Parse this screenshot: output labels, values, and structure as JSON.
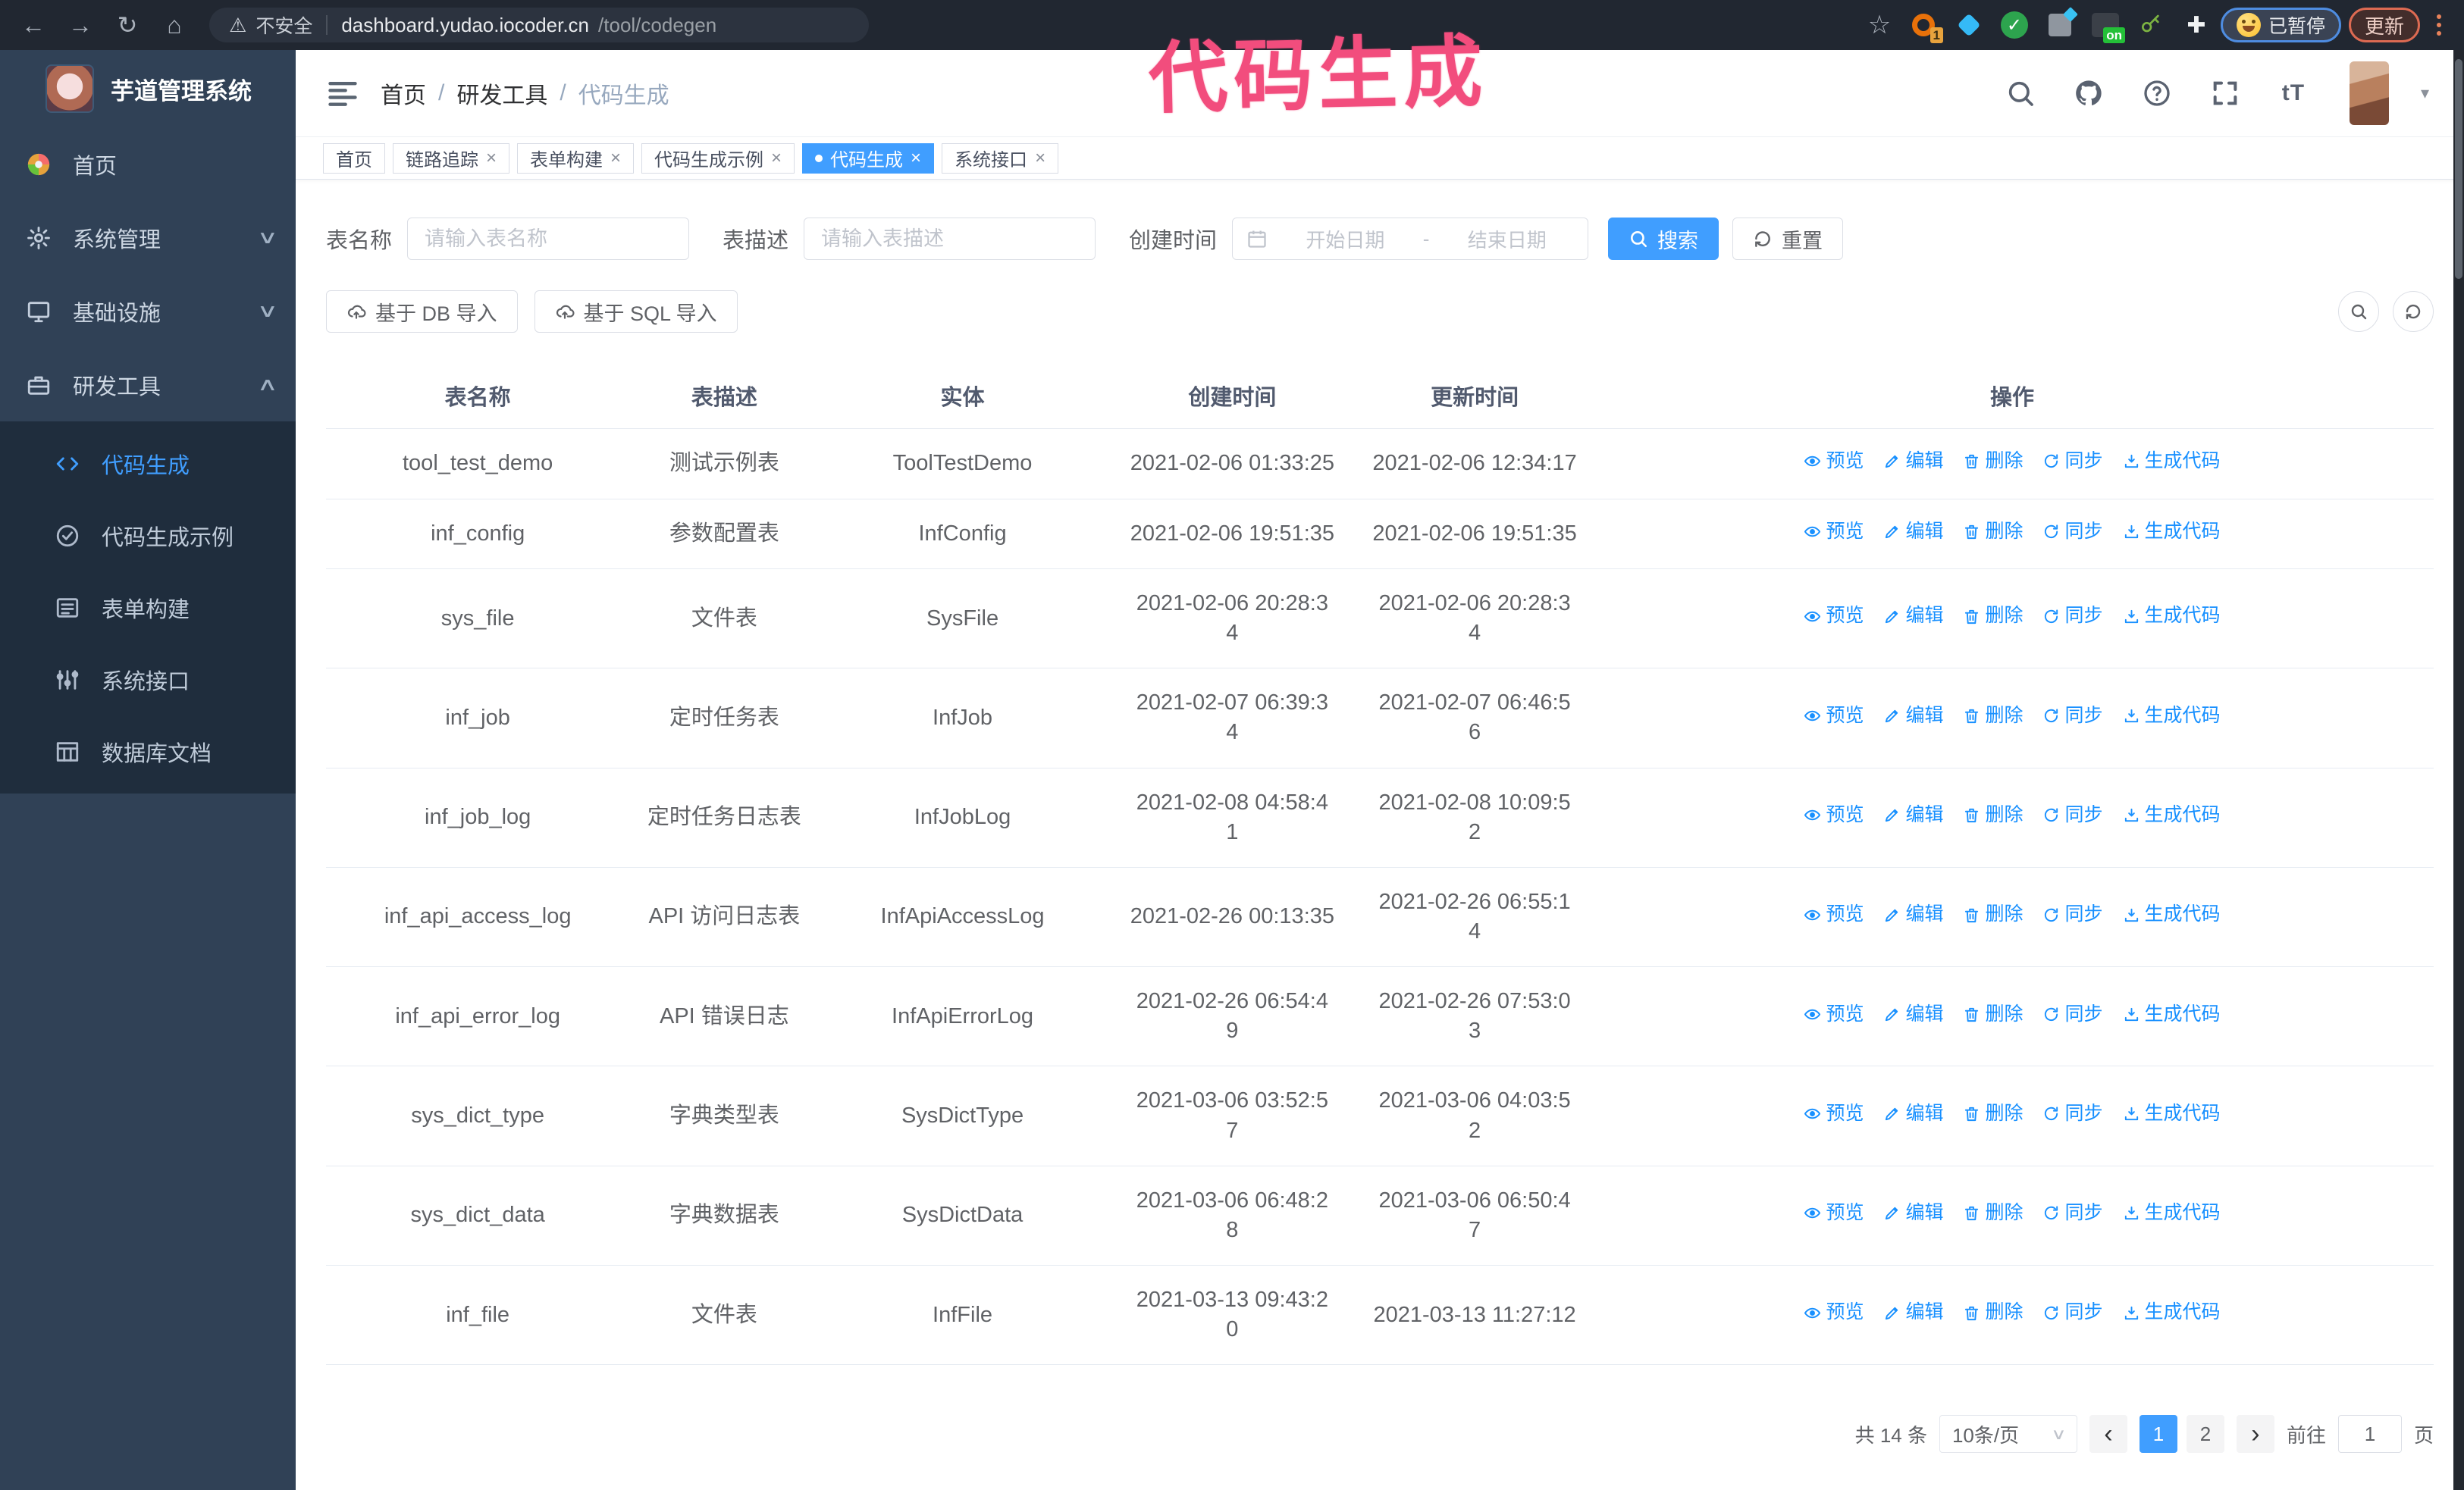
{
  "annotation": {
    "text": "代码生成"
  },
  "browser": {
    "security_label": "不安全",
    "url_host": "dashboard.yudao.iocoder.cn",
    "url_path": "/tool/codegen",
    "profile_label": "已暂停",
    "update_label": "更新",
    "extensions": [
      {
        "icon": "ring-orange-icon",
        "badge": "1"
      },
      {
        "icon": "gem-blue-icon",
        "badge": ""
      },
      {
        "icon": "check-green-icon",
        "badge": ""
      },
      {
        "icon": "panels-gray-icon",
        "badge": ""
      },
      {
        "icon": "switch-dark-icon",
        "badge": "on"
      },
      {
        "icon": "key-green-icon",
        "badge": ""
      },
      {
        "icon": "puzzle-white-icon",
        "badge": ""
      }
    ]
  },
  "icons": {
    "back": "←",
    "forward": "→",
    "reload": "↻",
    "home": "⌂",
    "star": "☆",
    "warning": "⚠",
    "close": "×",
    "chevron_down": "∨",
    "chevron_up": "∧",
    "prev": "‹",
    "next": "›",
    "check": "✓",
    "puzzle": "✚",
    "text_size": "tT",
    "caret_down": "▾"
  },
  "sidebar": {
    "logo_title": "芋道管理系统",
    "items": [
      {
        "key": "home",
        "label": "首页",
        "icon": "dashboard",
        "chevron": ""
      },
      {
        "key": "system-admin",
        "label": "系统管理",
        "icon": "gear",
        "chevron": "down"
      },
      {
        "key": "infrastructure",
        "label": "基础设施",
        "icon": "monitor",
        "chevron": "down"
      },
      {
        "key": "dev-tools",
        "label": "研发工具",
        "icon": "toolbox",
        "chevron": "up"
      }
    ],
    "submenu": [
      {
        "key": "codegen",
        "label": "代码生成",
        "icon": "code",
        "active": true
      },
      {
        "key": "codegen-example",
        "label": "代码生成示例",
        "icon": "badgecheck",
        "active": false
      },
      {
        "key": "form-builder",
        "label": "表单构建",
        "icon": "form",
        "active": false
      },
      {
        "key": "system-api",
        "label": "系统接口",
        "icon": "sliders",
        "active": false
      },
      {
        "key": "db-doc",
        "label": "数据库文档",
        "icon": "dbdoc",
        "active": false
      }
    ]
  },
  "header": {
    "breadcrumb": [
      "首页",
      "研发工具",
      "代码生成"
    ],
    "separator": "/"
  },
  "tabs": [
    {
      "label": "首页",
      "closable": false,
      "active": false
    },
    {
      "label": "链路追踪",
      "closable": true,
      "active": false
    },
    {
      "label": "表单构建",
      "closable": true,
      "active": false
    },
    {
      "label": "代码生成示例",
      "closable": true,
      "active": false
    },
    {
      "label": "代码生成",
      "closable": true,
      "active": true
    },
    {
      "label": "系统接口",
      "closable": true,
      "active": false
    }
  ],
  "filters": {
    "name_label": "表名称",
    "name_placeholder": "请输入表名称",
    "desc_label": "表描述",
    "desc_placeholder": "请输入表描述",
    "time_label": "创建时间",
    "start_placeholder": "开始日期",
    "range_separator": "-",
    "end_placeholder": "结束日期",
    "search_label": "搜索",
    "reset_label": "重置"
  },
  "toolbar": {
    "import_db": "基于 DB 导入",
    "import_sql": "基于 SQL 导入"
  },
  "table": {
    "columns": [
      "表名称",
      "表描述",
      "实体",
      "创建时间",
      "更新时间",
      "操作"
    ],
    "actions": [
      {
        "key": "preview",
        "label": "预览",
        "icon": "eye"
      },
      {
        "key": "edit",
        "label": "编辑",
        "icon": "edit"
      },
      {
        "key": "delete",
        "label": "删除",
        "icon": "trash"
      },
      {
        "key": "sync",
        "label": "同步",
        "icon": "sync"
      },
      {
        "key": "generate",
        "label": "生成代码",
        "icon": "download"
      }
    ],
    "rows": [
      {
        "name": "tool_test_demo",
        "desc": "测试示例表",
        "entity": "ToolTestDemo",
        "created": "2021-02-06 01:33:25",
        "updated": "2021-02-06 12:34:17",
        "created_wrap": false,
        "updated_wrap": false
      },
      {
        "name": "inf_config",
        "desc": "参数配置表",
        "entity": "InfConfig",
        "created": "2021-02-06 19:51:35",
        "updated": "2021-02-06 19:51:35",
        "created_wrap": false,
        "updated_wrap": false
      },
      {
        "name": "sys_file",
        "desc": "文件表",
        "entity": "SysFile",
        "created": "2021-02-06 20:28:34",
        "updated": "2021-02-06 20:28:34",
        "created_wrap": true,
        "updated_wrap": true
      },
      {
        "name": "inf_job",
        "desc": "定时任务表",
        "entity": "InfJob",
        "created": "2021-02-07 06:39:34",
        "updated": "2021-02-07 06:46:56",
        "created_wrap": true,
        "updated_wrap": true
      },
      {
        "name": "inf_job_log",
        "desc": "定时任务日志表",
        "entity": "InfJobLog",
        "created": "2021-02-08 04:58:41",
        "updated": "2021-02-08 10:09:52",
        "created_wrap": true,
        "updated_wrap": true
      },
      {
        "name": "inf_api_access_log",
        "desc": "API 访问日志表",
        "entity": "InfApiAccessLog",
        "created": "2021-02-26 00:13:35",
        "updated": "2021-02-26 06:55:14",
        "created_wrap": false,
        "updated_wrap": true
      },
      {
        "name": "inf_api_error_log",
        "desc": "API 错误日志",
        "entity": "InfApiErrorLog",
        "created": "2021-02-26 06:54:49",
        "updated": "2021-02-26 07:53:03",
        "created_wrap": true,
        "updated_wrap": true
      },
      {
        "name": "sys_dict_type",
        "desc": "字典类型表",
        "entity": "SysDictType",
        "created": "2021-03-06 03:52:57",
        "updated": "2021-03-06 04:03:52",
        "created_wrap": true,
        "updated_wrap": true
      },
      {
        "name": "sys_dict_data",
        "desc": "字典数据表",
        "entity": "SysDictData",
        "created": "2021-03-06 06:48:28",
        "updated": "2021-03-06 06:50:47",
        "created_wrap": true,
        "updated_wrap": true
      },
      {
        "name": "inf_file",
        "desc": "文件表",
        "entity": "InfFile",
        "created": "2021-03-13 09:43:20",
        "updated": "2021-03-13 11:27:12",
        "created_wrap": true,
        "updated_wrap": false
      }
    ]
  },
  "pagination": {
    "total": "共 14 条",
    "page_size": "10条/页",
    "pages": [
      "1",
      "2"
    ],
    "active_page": "1",
    "goto_label": "前往",
    "goto_value": "1",
    "page_label": "页"
  },
  "colors": {
    "accent": "#409eff",
    "link": "#1890ff",
    "annotation": "#f24d7d",
    "sidebar_bg": "#304156",
    "submenu_bg": "#1f2d3d",
    "browser_bg": "#212731"
  }
}
